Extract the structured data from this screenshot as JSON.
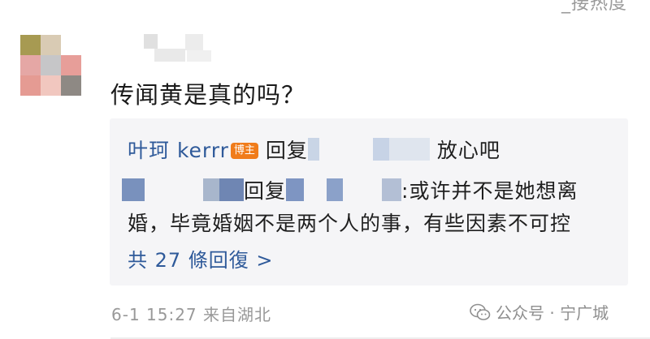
{
  "header": {
    "sort_label": "_接热度"
  },
  "comment": {
    "text": "传闻黄是真的吗？",
    "timestamp": "6-1 15:27",
    "location": "来自湖北"
  },
  "replies": [
    {
      "author": "叶珂 kerrr",
      "badge": "博主",
      "reply_word": "回复",
      "text": "放心吧"
    },
    {
      "reply_word": "回复",
      "text_line1": ":或许并不是她想离",
      "text_line2": "婚，毕竟婚姻不是两个人的事，有些因素不可控"
    }
  ],
  "more_replies_label": "共 27 條回復 >",
  "watermark": {
    "text": "公众号 · 宁广城"
  }
}
